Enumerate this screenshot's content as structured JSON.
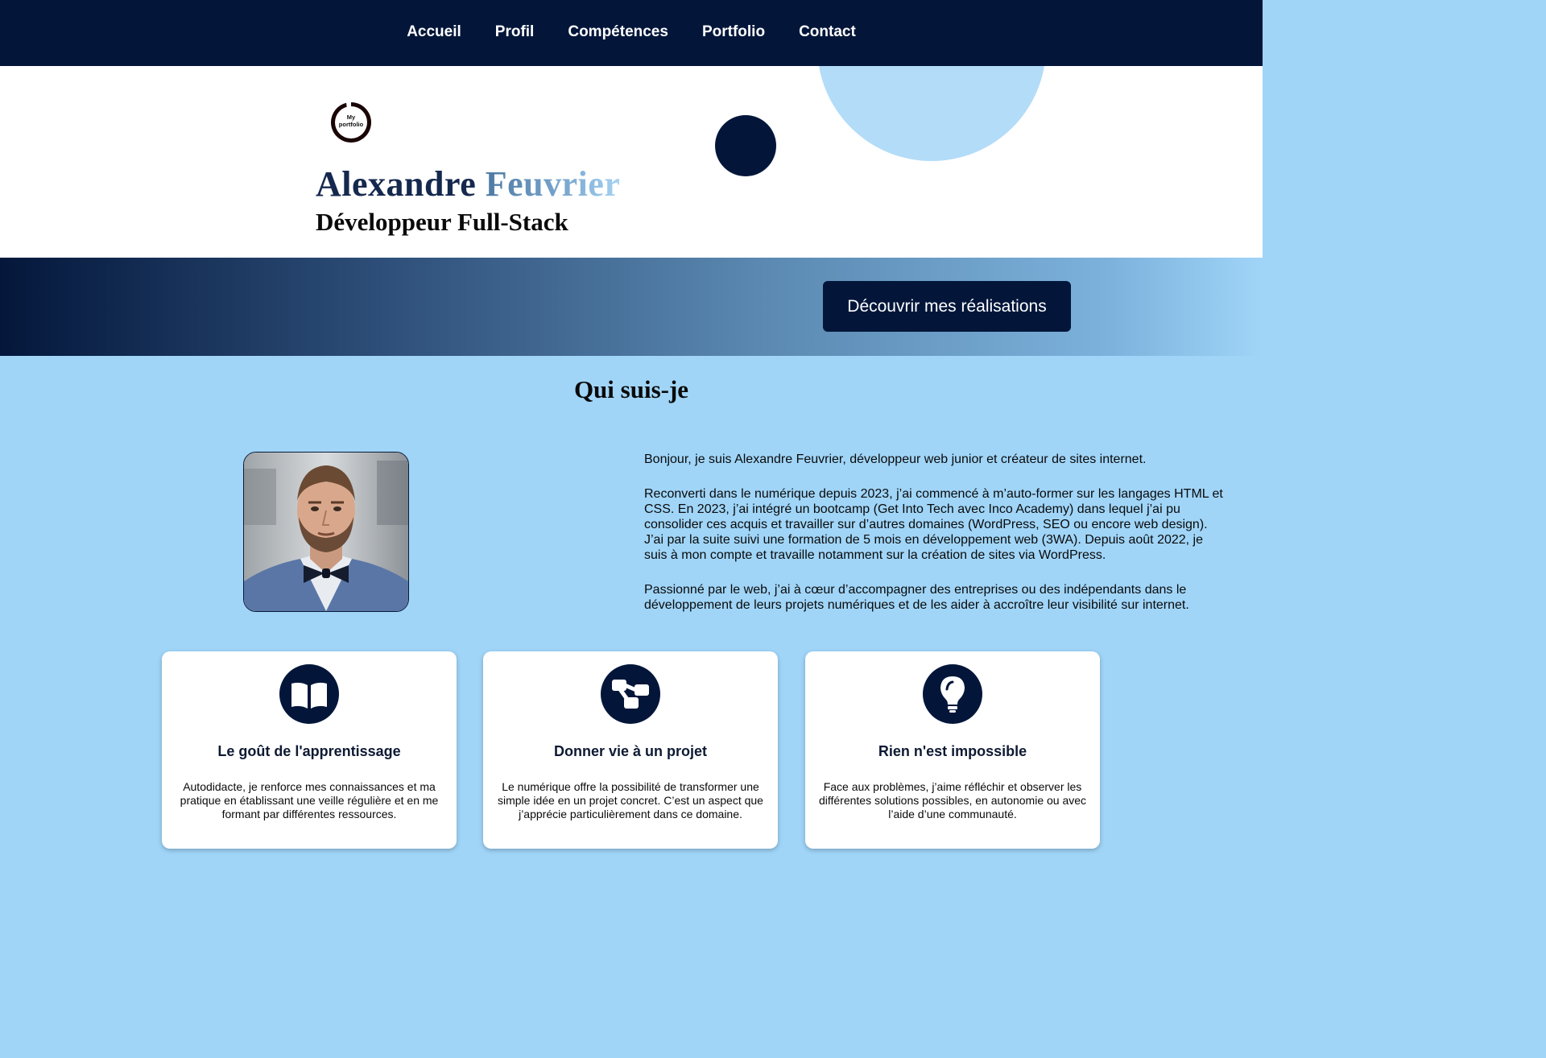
{
  "nav": {
    "items": [
      "Accueil",
      "Profil",
      "Compétences",
      "Portfolio",
      "Contact"
    ]
  },
  "hero": {
    "logo_text_line1": "My",
    "logo_text_line2": "portfolio",
    "first_name": "Alexandre",
    "last_name": "Feuvrier",
    "role": "Développeur Full-Stack"
  },
  "band": {
    "cta_label": "Découvrir mes réalisations"
  },
  "about": {
    "title": "Qui suis-je",
    "photo_alt": "Photo de profil",
    "paragraphs": [
      "Bonjour, je suis Alexandre Feuvrier, développeur web junior et créateur de sites internet.",
      "Reconverti dans le numérique depuis 2023, j’ai commencé à m’auto-former sur les langages HTML et CSS. En 2023, j’ai intégré un bootcamp (Get Into Tech avec Inco Academy) dans lequel j’ai pu consolider ces acquis et travailler sur d’autres domaines (WordPress, SEO ou encore web design). J’ai par la suite suivi une formation de 5 mois en développement web (3WA). Depuis août 2022, je suis à mon compte et travaille notamment sur la création de sites via WordPress.",
      "Passionné par le web, j’ai à cœur d’accompagner des entreprises ou des indépendants dans le développement de leurs projets numériques et de les aider à accroître leur visibilité sur internet."
    ]
  },
  "cards": [
    {
      "icon": "book-open-icon",
      "title": "Le goût de l'apprentissage",
      "text": "Autodidacte, je renforce mes connaissances et ma pratique en établissant une veille régulière et en me formant par différentes ressources."
    },
    {
      "icon": "project-diagram-icon",
      "title": "Donner vie à un projet",
      "text": "Le numérique offre la possibilité de transformer une simple idée en un projet concret. C’est un aspect que j’apprécie particulièrement dans ce domaine."
    },
    {
      "icon": "lightbulb-icon",
      "title": "Rien n'est impossible",
      "text": "Face aux problèmes, j’aime réfléchir et observer les différentes solutions possibles, en autonomie ou avec l’aide d’une communauté."
    }
  ],
  "colors": {
    "navy": "#03163a",
    "light_blue": "#a0d5f8",
    "circle_light": "#b3dcf8",
    "white": "#ffffff"
  }
}
